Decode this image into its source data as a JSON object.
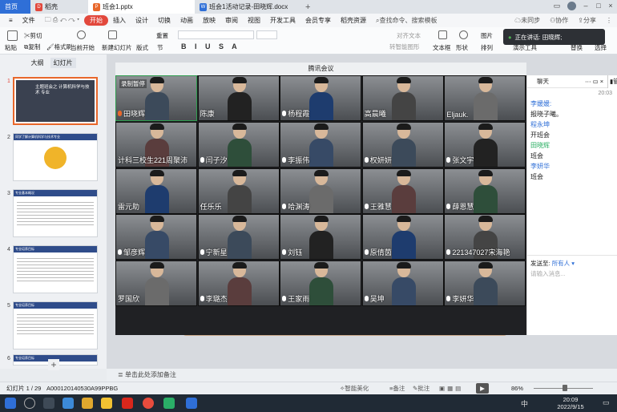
{
  "tabs": {
    "home": "首页",
    "doc": "稻壳",
    "ppt": "班会1.pptx",
    "word": "班会1活动记录-田晓辉.docx",
    "add": "+"
  },
  "menu": {
    "file": "文件",
    "items": [
      "开始",
      "插入",
      "设计",
      "切换",
      "动画",
      "放映",
      "审阅",
      "视图",
      "开发工具",
      "会员专享",
      "稻壳资源"
    ],
    "search": "查找命令、搜索模板",
    "unsync": "未同步",
    "collab": "协作",
    "share": "分享"
  },
  "toolbar": {
    "paste": "粘贴",
    "cut": "剪切",
    "copy": "复制",
    "format_painter": "格式刷",
    "from_current": "当前开始",
    "new_slide": "新建幻灯片",
    "layout": "版式",
    "section": "节",
    "reset": "重置",
    "align_text": "对齐文本",
    "convert_smartart": "转智能图形",
    "textbox": "文本框",
    "shape": "形状",
    "arrange": "排列",
    "picture": "图片",
    "fill": "填充",
    "find": "查找",
    "replace": "替换",
    "select": "选择",
    "presenter": "演示工具"
  },
  "floating": {
    "text": "正在讲话: 田晓辉;"
  },
  "slide_panel": {
    "tab_outline": "大纲",
    "tab_slides": "幻灯片",
    "add": "+"
  },
  "slides": [
    {
      "num": "1",
      "title": "主题班会之 计算机科学与技术 专业"
    },
    {
      "num": "2",
      "title": "同学了解计算机科学与技术专业"
    },
    {
      "num": "3",
      "title": "专业基本概况"
    },
    {
      "num": "4",
      "title": "专业培养目标"
    },
    {
      "num": "5",
      "title": "专业培养目标"
    },
    {
      "num": "6",
      "title": "专业培养目标"
    }
  ],
  "meeting": {
    "title": "腾讯会议",
    "recording": "录制暂停",
    "participants": [
      "田晓辉",
      "陈康",
      "杨程霞",
      "高晨曦",
      "Eljauk.",
      "计科三校生221周聚沛",
      "闫子汐",
      "李振伟",
      "权妍妍",
      "张文宇",
      "雷元助",
      "任乐乐",
      "哈渊涛",
      "王雅慧",
      "薛恩慧",
      "邹彦辉",
      "宁新星",
      "刘钰",
      "原倩茵",
      "221347027宋海艳",
      "罗国欣",
      "李璐杰",
      "王家雨",
      "吴坤",
      "李妍华"
    ]
  },
  "chat": {
    "title": "聊天",
    "manage": "管理",
    "time": "20:03",
    "lines": [
      {
        "text": "李媛媛:",
        "style": "blue"
      },
      {
        "text": "报晓子曦。",
        "style": "black"
      },
      {
        "text": "程永坤",
        "style": "blue"
      },
      {
        "text": "开班会",
        "style": "black"
      },
      {
        "text": "田晓辉",
        "style": "green"
      },
      {
        "text": "班会",
        "style": "black"
      },
      {
        "text": "李妍华",
        "style": "blue"
      },
      {
        "text": "班会",
        "style": "black"
      }
    ],
    "send_to_label": "发送至:",
    "send_to_value": "所有人",
    "input_placeholder": "请输入消息..."
  },
  "notes": {
    "placeholder": "单击此处添加备注"
  },
  "status": {
    "slide_info": "幻灯片 1 / 29",
    "file_id": "A000120140530A99PPBG",
    "smart_beautify": "智能美化",
    "notes": "备注",
    "comments": "批注",
    "zoom": "86%"
  },
  "taskbar": {
    "time": "20:09",
    "date": "2022/9/15",
    "ime": "中"
  },
  "colors": {
    "accent": "#2f6fd7",
    "start_tab": "#e2483c",
    "meeting_bg": "#202124"
  }
}
